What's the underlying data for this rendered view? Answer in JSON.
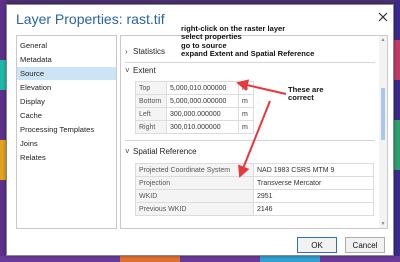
{
  "dialog": {
    "title": "Layer Properties: rast.tif"
  },
  "nav": {
    "items": [
      {
        "label": "General",
        "selected": false
      },
      {
        "label": "Metadata",
        "selected": false
      },
      {
        "label": "Source",
        "selected": true
      },
      {
        "label": "Elevation",
        "selected": false
      },
      {
        "label": "Display",
        "selected": false
      },
      {
        "label": "Cache",
        "selected": false
      },
      {
        "label": "Processing Templates",
        "selected": false
      },
      {
        "label": "Joins",
        "selected": false
      },
      {
        "label": "Relates",
        "selected": false
      }
    ]
  },
  "content": {
    "statistics_label": "Statistics",
    "extent_label": "Extent",
    "extent_rows": [
      {
        "label": "Top",
        "value": "5,000,010.000000",
        "unit": "m"
      },
      {
        "label": "Bottom",
        "value": "5,000,000.000000",
        "unit": "m"
      },
      {
        "label": "Left",
        "value": "300,000.000000",
        "unit": "m"
      },
      {
        "label": "Right",
        "value": "300,010.000000",
        "unit": "m"
      }
    ],
    "spatial_label": "Spatial Reference",
    "sr_rows": [
      {
        "label": "Projected Coordinate System",
        "value": "NAD 1983 CSRS MTM  9"
      },
      {
        "label": "Projection",
        "value": "Transverse Mercator"
      },
      {
        "label": "WKID",
        "value": "2951"
      },
      {
        "label": "Previous WKID",
        "value": "2146"
      }
    ]
  },
  "annotations": {
    "instructions": [
      "right-click on the raster layer",
      "select properties",
      "go to source",
      "expand Extent and Spatial Reference"
    ],
    "correct": [
      "These are",
      "correct"
    ]
  },
  "buttons": {
    "ok": "OK",
    "cancel": "Cancel"
  },
  "colors": {
    "arrow": "#e8383d",
    "selected_nav": "#cde4f7",
    "title": "#2a62a8"
  }
}
